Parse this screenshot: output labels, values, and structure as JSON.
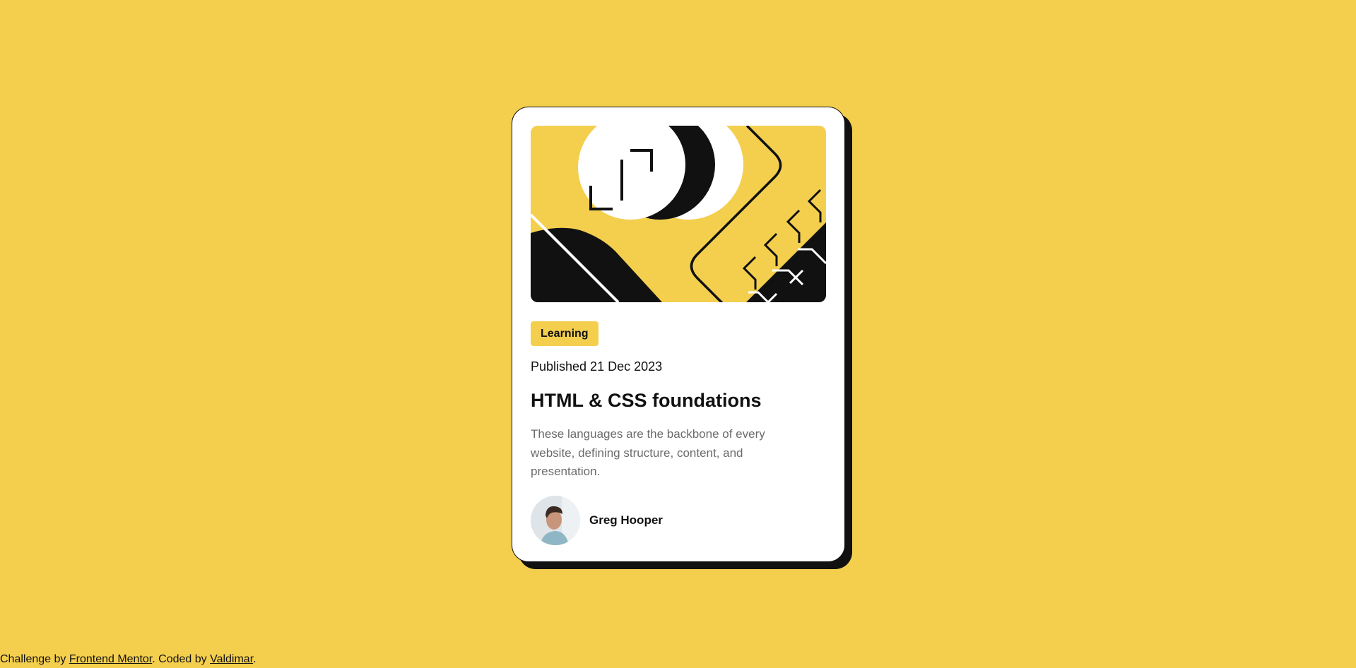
{
  "colors": {
    "background": "#f4cf4e",
    "card": "#ffffff",
    "ink": "#111111",
    "muted_text": "#6b6b6b",
    "tag_background": "#f4cf4e"
  },
  "card": {
    "hero_image": "illustration-article",
    "tag": "Learning",
    "published": "Published 21 Dec 2023",
    "title": "HTML & CSS foundations",
    "description": "These languages are the backbone of every website, defining structure, content, and presentation.",
    "author": {
      "avatar": "image-avatar",
      "name": "Greg Hooper"
    }
  },
  "attribution": {
    "prefix": "Challenge by ",
    "link1": "Frontend Mentor",
    "middle": ". Coded by ",
    "link2": "Valdimar",
    "suffix": "."
  }
}
